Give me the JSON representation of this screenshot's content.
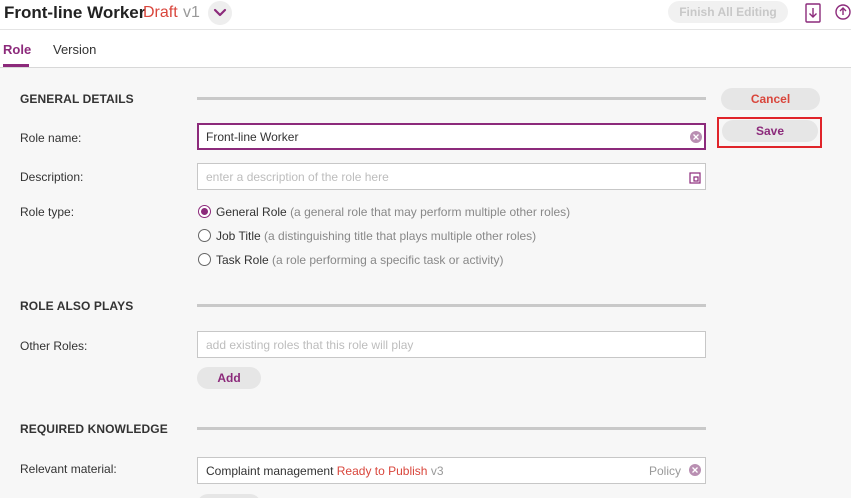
{
  "header": {
    "title": "Front-line Worker",
    "status": "Draft",
    "version": "v1",
    "finish_label": "Finish All Editing"
  },
  "tabs": [
    {
      "label": "Role",
      "active": true
    },
    {
      "label": "Version",
      "active": false
    }
  ],
  "actions": {
    "cancel_label": "Cancel",
    "save_label": "Save"
  },
  "general": {
    "title": "GENERAL DETAILS",
    "role_name_label": "Role name:",
    "role_name_value": "Front-line Worker",
    "description_label": "Description:",
    "description_placeholder": "enter a description of the role here",
    "role_type_label": "Role type:",
    "role_types": [
      {
        "name": "General Role",
        "hint": "(a general role that may perform multiple other roles)",
        "selected": true
      },
      {
        "name": "Job Title",
        "hint": "(a distinguishing title that plays multiple other roles)",
        "selected": false
      },
      {
        "name": "Task Role",
        "hint": "(a role performing a specific task or activity)",
        "selected": false
      }
    ]
  },
  "also_plays": {
    "title": "ROLE ALSO PLAYS",
    "other_roles_label": "Other Roles:",
    "other_roles_placeholder": "add existing roles that this role will play",
    "add_label": "Add"
  },
  "knowledge": {
    "title": "REQUIRED KNOWLEDGE",
    "material_label": "Relevant material:",
    "material_name": "Complaint management",
    "material_status": "Ready to Publish",
    "material_version": "v3",
    "material_type": "Policy"
  },
  "colors": {
    "accent": "#8c2a7b",
    "status": "#d9463c",
    "highlight": "#e0242a"
  }
}
